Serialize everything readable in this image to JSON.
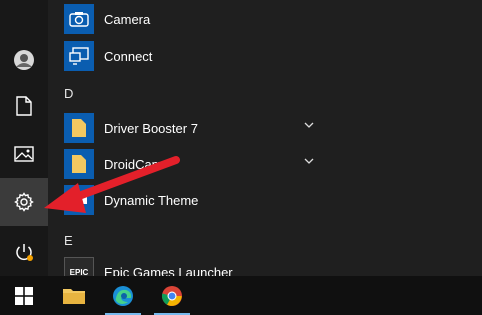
{
  "left_rail": {
    "items": [
      {
        "name": "user-avatar",
        "icon": "avatar-icon"
      },
      {
        "name": "documents",
        "icon": "document-icon"
      },
      {
        "name": "pictures",
        "icon": "picture-icon"
      },
      {
        "name": "settings",
        "icon": "gear-icon",
        "selected": true
      },
      {
        "name": "power",
        "icon": "power-icon",
        "badge_color": "#f4a100"
      }
    ]
  },
  "apps": {
    "camera": {
      "label": "Camera",
      "tile_color": "#0a5db0"
    },
    "connect": {
      "label": "Connect",
      "tile_color": "#0a5db0"
    },
    "header_d": "D",
    "driver_booster": {
      "label": "Driver Booster 7",
      "tile_color": "#0a5db0",
      "expandable": true
    },
    "droidcam": {
      "label": "DroidCam",
      "tile_color": "#0a5db0",
      "expandable": true
    },
    "dynamic_theme": {
      "label": "Dynamic Theme",
      "tile_color": "#0a5db0"
    },
    "header_e": "E",
    "epic": {
      "label": "Epic Games Launcher",
      "tile_label": "EPIC",
      "tile_color": "#2a2a2a"
    }
  },
  "taskbar": {
    "items": [
      {
        "name": "start",
        "icon": "windows-logo-icon"
      },
      {
        "name": "file-explorer",
        "icon": "folder-icon"
      },
      {
        "name": "edge",
        "icon": "edge-icon"
      },
      {
        "name": "chrome",
        "icon": "chrome-icon"
      }
    ]
  },
  "colors": {
    "accent": "#0a5db0",
    "annotation_arrow": "#e3202a"
  }
}
